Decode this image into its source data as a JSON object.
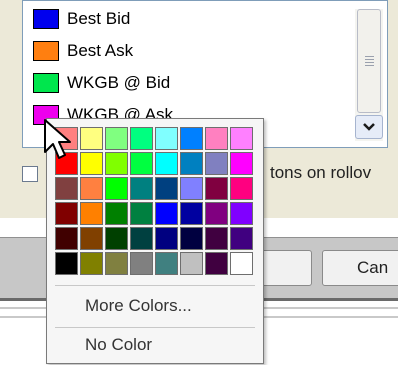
{
  "list": {
    "items": [
      {
        "label": "Best Bid",
        "color": "#0000ee"
      },
      {
        "label": "Best Ask",
        "color": "#ff7f10"
      },
      {
        "label": "WKGB @ Bid",
        "color": "#00e64d"
      },
      {
        "label": "WKGB @ Ask",
        "color": "#ee00ee"
      }
    ]
  },
  "options": {
    "checkbox_label": "tons on rollov"
  },
  "buttons": {
    "cancel_label": "Can"
  },
  "color_picker": {
    "colors": [
      [
        "#ff8080",
        "#ffff80",
        "#80ff80",
        "#00ff80",
        "#80ffff",
        "#0080ff",
        "#ff80c0",
        "#ff80ff"
      ],
      [
        "#ff0000",
        "#ffff00",
        "#80ff00",
        "#00ff40",
        "#00ffff",
        "#0080c0",
        "#8080c0",
        "#ff00ff"
      ],
      [
        "#804040",
        "#ff8040",
        "#00ff00",
        "#008080",
        "#004080",
        "#8080ff",
        "#800040",
        "#ff0080"
      ],
      [
        "#800000",
        "#ff8000",
        "#008000",
        "#008040",
        "#0000ff",
        "#0000a0",
        "#800080",
        "#8000ff"
      ],
      [
        "#400000",
        "#804000",
        "#004000",
        "#004040",
        "#000080",
        "#000040",
        "#400040",
        "#400080"
      ],
      [
        "#000000",
        "#808000",
        "#808040",
        "#808080",
        "#408080",
        "#c0c0c0",
        "#400040",
        "#ffffff"
      ]
    ],
    "more_colors_label": "More Colors...",
    "no_color_label": "No Color"
  }
}
